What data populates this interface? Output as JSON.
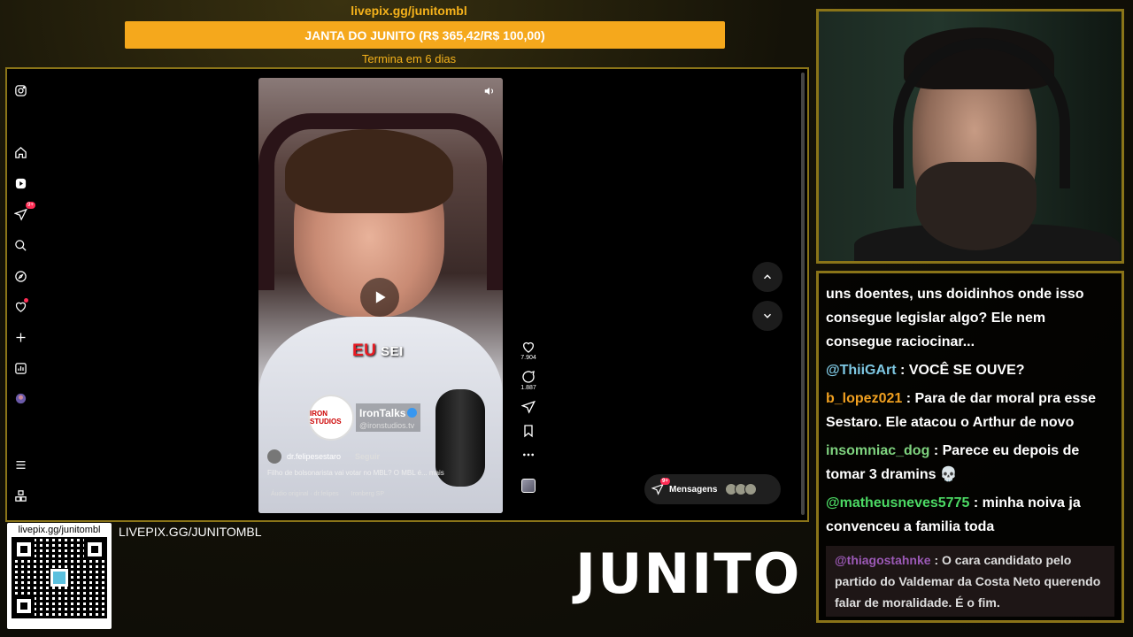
{
  "goal": {
    "url": "livepix.gg/junitombl",
    "title": "JANTA DO JUNITO (R$ 365,42/R$ 100,00)",
    "ends": "Termina em 6 dias"
  },
  "instagram": {
    "notifications_badge": "9+",
    "video": {
      "caption_red": "EU",
      "caption_white": "SEI",
      "brand_logo_text": "IRON STUDIOS",
      "brand_name": "IronTalks",
      "brand_handle": "@ironstudios.tv",
      "username": "dr.felipesestaro",
      "follow_label": "Seguir",
      "description": "Filho de bolsonarista vai votar no MBL? O MBL é... mais",
      "audio": "Áudio original · dr.felipes",
      "location": "Ironberg SP"
    },
    "actions": {
      "likes": "7.904",
      "comments": "1.887"
    },
    "messages": {
      "label": "Mensagens",
      "badge": "9+"
    }
  },
  "chat": {
    "messages": [
      {
        "user": "",
        "user_color": "#ffffff",
        "text": "uns doentes, uns doidinhos onde isso consegue legislar algo? Ele nem consegue raciocinar..."
      },
      {
        "user": "@ThiiGArt",
        "user_color": "#7ec8e3",
        "text": ": VOCÊ SE OUVE?"
      },
      {
        "user": "b_lopez021",
        "user_color": "#f0a020",
        "text": ": Para de dar moral pra esse Sestaro. Ele atacou o Arthur de novo"
      },
      {
        "user": "insomniac_dog",
        "user_color": "#7fd37f",
        "text": ": Parece eu depois de tomar 3 dramins 💀"
      },
      {
        "user": "@matheusneves5775",
        "user_color": "#4cd964",
        "text": ": minha noiva ja convenceu a familia toda"
      },
      {
        "user": "@thiagostahnke",
        "user_color": "#9b59b6",
        "text": ": O cara candidato pelo partido do Valdemar da Costa Neto querendo falar de moralidade. É o fim."
      }
    ]
  },
  "bottom": {
    "qr_url": "livepix.gg/junitombl",
    "livepix_label": "LIVEPIX.GG/JUNITOMBL",
    "logo": "JUNITO"
  }
}
